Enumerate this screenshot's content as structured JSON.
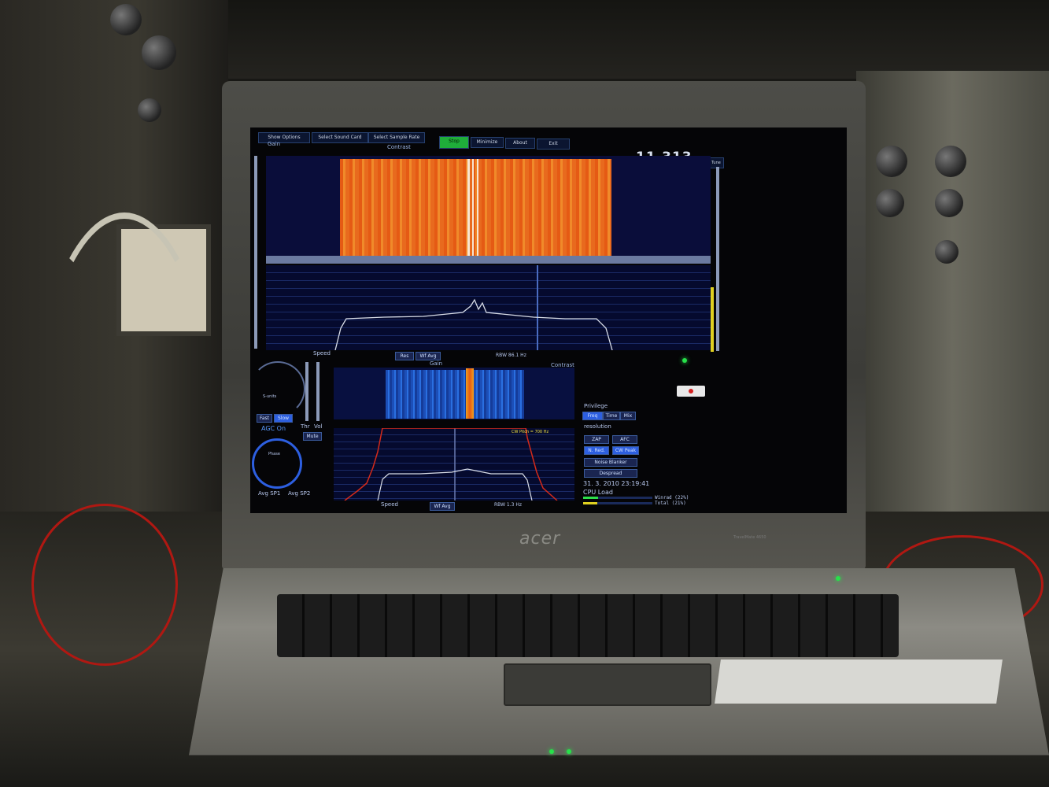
{
  "app": {
    "buttons": [
      "Show Options",
      "Select Sound Card",
      "Select Sample Rate",
      "Stop",
      "Minimize",
      "About",
      "Exit"
    ],
    "gain_label": "Gain",
    "contrast_label": "Contrast",
    "frequency": "11.313",
    "tune_label": "Tune",
    "speed_label": "Speed",
    "rbw_main": "RBW 86.1 Hz",
    "rbw_sub": "RBW 1.3 Hz",
    "wf_avg": "Wf Avg",
    "res_label": "Res",
    "agc_label": "AGC On",
    "fast_label": "Fast",
    "slow_label": "Slow",
    "thr_label": "Thr",
    "vol_label": "Vol",
    "mute_label": "Mute",
    "phase_label": "Phase",
    "avg_sp1": "Avg SP1",
    "avg_sp2": "Avg SP2",
    "cw_pitch": "CW Pitch = 700 Hz",
    "privilege_label": "Privilege",
    "privilege_tabs": [
      "Freq",
      "Time",
      "Mix"
    ],
    "resolution_label": "resolution",
    "res_buttons": [
      "ZAP",
      "AFC",
      "N. Red.",
      "CW Peak",
      "Noise Blanker",
      "Despread"
    ],
    "datetime": "31. 3. 2010 23:19:41",
    "cpu_label": "CPU Load",
    "cpu_winrad": "Winrad  (22%)",
    "cpu_total": "Total   (21%)",
    "smeter_label": "S-units"
  },
  "laptop": {
    "brand": "acer",
    "model": "TravelMate 4650"
  },
  "colors": {
    "waterfall_band": "#e8661c",
    "waterfall_bg": "#0a0d3a",
    "spectrum_line": "#d8dde8",
    "filter_line": "#d42a1a",
    "accent_green": "#1fae3a",
    "ui_blue": "#2d5fe0"
  }
}
